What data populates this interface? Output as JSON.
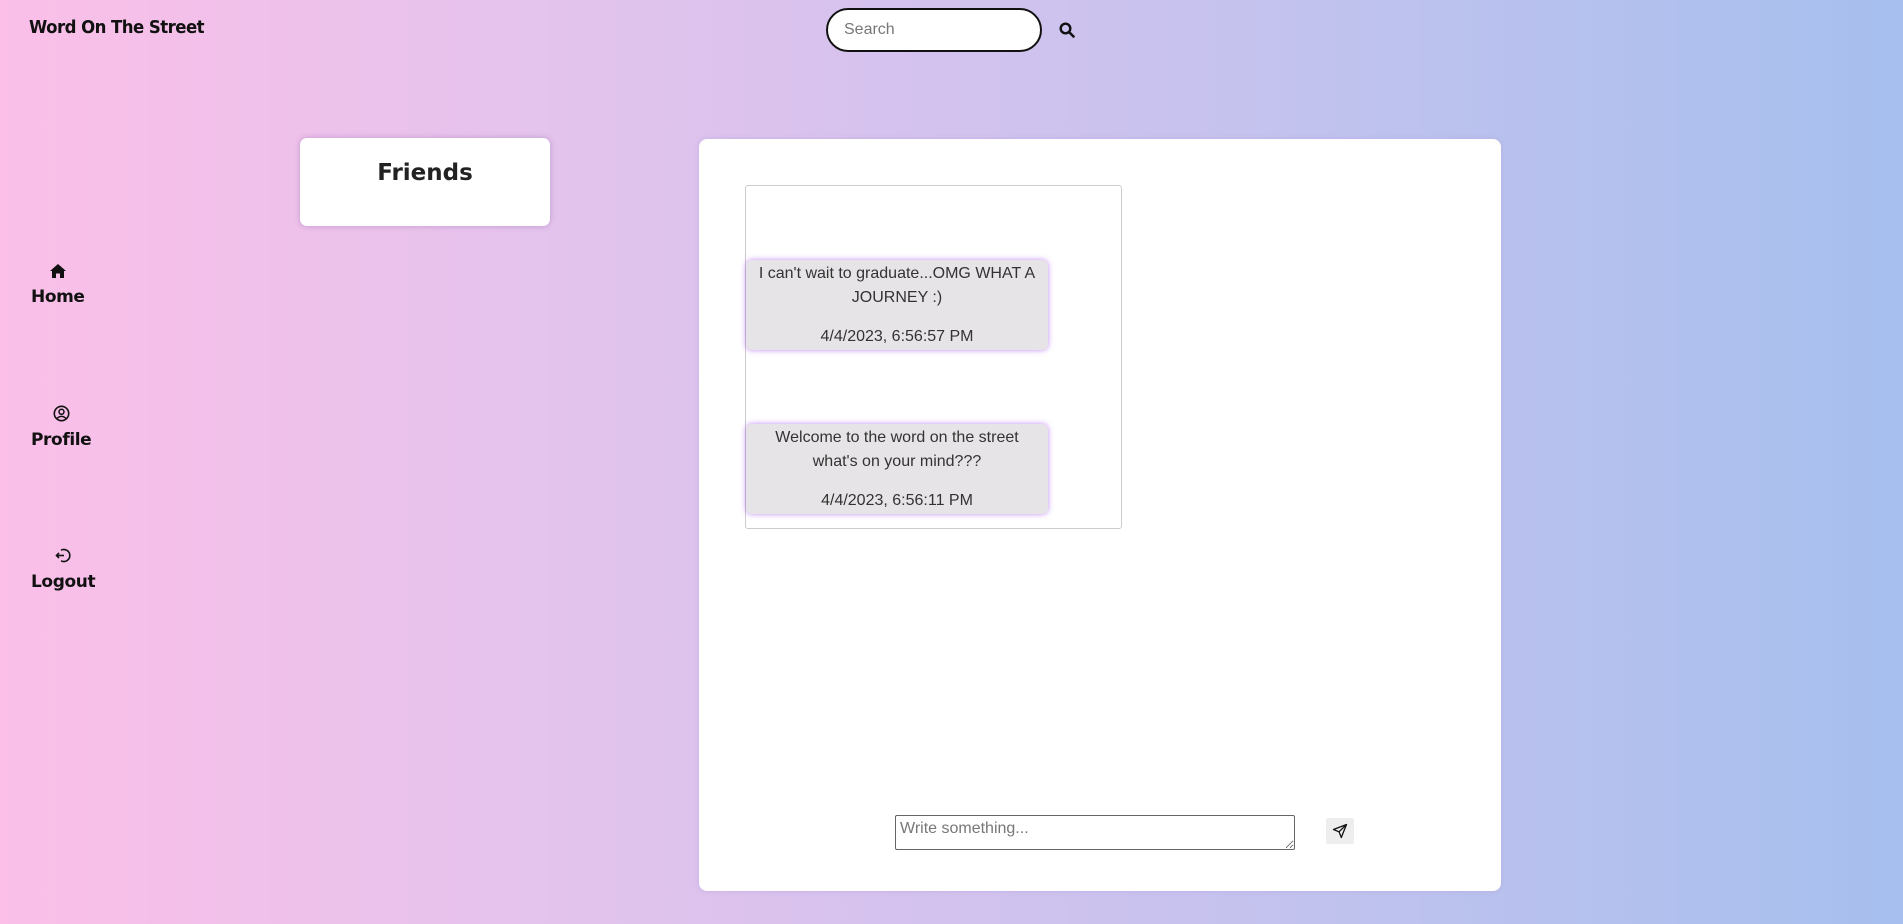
{
  "header": {
    "brand": "Word On The Street",
    "search_placeholder": "Search",
    "search_icon": "search-icon"
  },
  "nav": {
    "items": [
      {
        "label": "Home",
        "icon": "home-icon"
      },
      {
        "label": "Profile",
        "icon": "user-circle-icon"
      },
      {
        "label": "Logout",
        "icon": "logout-icon"
      }
    ]
  },
  "friends": {
    "title": "Friends"
  },
  "feed": {
    "posts": [
      {
        "text": "I can't wait to graduate...OMG WHAT A JOURNEY :)",
        "time": "4/4/2023, 6:56:57 PM"
      },
      {
        "text": "Welcome to the word on the street what's on your mind???",
        "time": "4/4/2023, 6:56:11 PM"
      }
    ]
  },
  "composer": {
    "placeholder": "Write something...",
    "send_icon": "send-icon"
  },
  "colors": {
    "gradient_start": "#fbbfe8",
    "gradient_end": "#a6bfee",
    "post_glow": "#aa5af0",
    "post_bg": "#e6e4e6"
  }
}
